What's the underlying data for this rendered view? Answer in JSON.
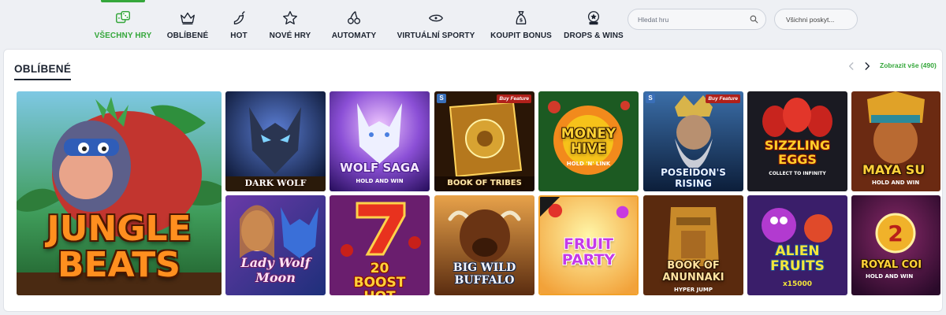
{
  "nav": {
    "items": [
      {
        "label": "VŠECHNY HRY",
        "icon": "dice-icon",
        "active": true
      },
      {
        "label": "OBLÍBENÉ",
        "icon": "crown-icon",
        "active": false
      },
      {
        "label": "HOT",
        "icon": "chili-icon",
        "active": false
      },
      {
        "label": "NOVÉ HRY",
        "icon": "star-icon",
        "active": false
      },
      {
        "label": "AUTOMATY",
        "icon": "cherries-icon",
        "active": false
      },
      {
        "label": "VIRTUÁLNÍ SPORTY",
        "icon": "ball-icon",
        "active": false
      },
      {
        "label": "KOUPIT BONUS",
        "icon": "money-bag-icon",
        "active": false
      },
      {
        "label": "DROPS & WINS",
        "icon": "drops-wins-icon",
        "active": false
      }
    ]
  },
  "search": {
    "placeholder": "Hledat hru"
  },
  "provider_filter": {
    "label": "Všichni poskyt..."
  },
  "section": {
    "title": "OBLÍBENÉ",
    "show_all": "Zobrazit vše (490)"
  },
  "games": [
    {
      "title": "JUNGLE BEATS"
    },
    {
      "title": "DARK WOLF"
    },
    {
      "title": "WOLF SAGA",
      "sub": "HOLD AND WIN"
    },
    {
      "title": "BOOK OF TRIBES",
      "badge": "Buy Feature"
    },
    {
      "title": "MONEY HIVE",
      "sub": "HOLD 'N' LINK"
    },
    {
      "title": "POSEIDON'S RISING",
      "badge": "Buy Feature"
    },
    {
      "title": "SIZZLING EGGS",
      "sub": "COLLECT TO INFINITY"
    },
    {
      "title": "MAYA SU",
      "sub": "HOLD AND WIN"
    },
    {
      "title": "Lady Wolf Moon"
    },
    {
      "title": "20 BOOST HOT"
    },
    {
      "title": "BIG WILD BUFFALO"
    },
    {
      "title": "FRUIT PARTY"
    },
    {
      "title": "BOOK OF ANUNNAKI",
      "sub": "HYPER JUMP"
    },
    {
      "title": "ALIEN FRUITS",
      "sub": "x15000"
    },
    {
      "title": "ROYAL COI",
      "sub": "HOLD AND WIN"
    }
  ],
  "colors": {
    "accent": "#35a73b",
    "text": "#1c2330"
  }
}
